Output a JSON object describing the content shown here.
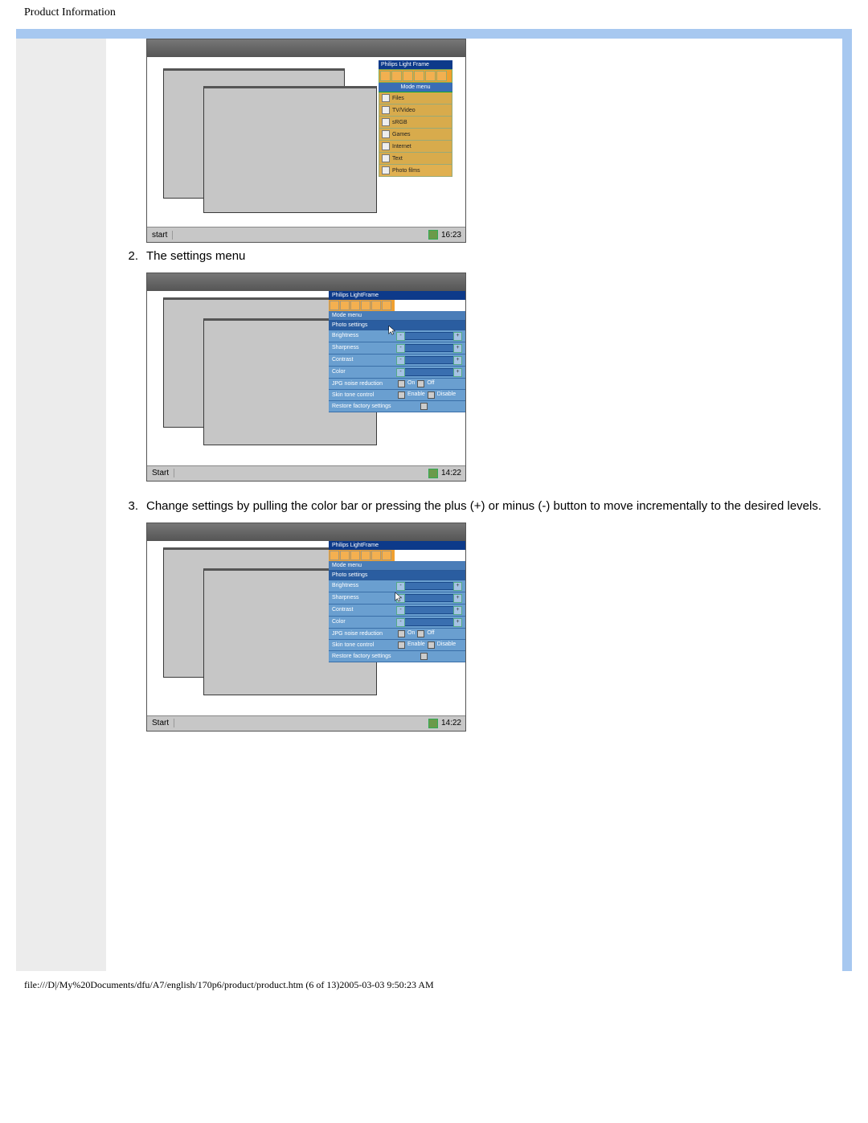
{
  "header": "Product Information",
  "steps": {
    "s2_num": "2.",
    "s2_text": "The settings menu",
    "s3_num": "3.",
    "s3_text": "Change settings by pulling the color bar or pressing the plus (+) or minus (-) button to move incrementally to the desired levels."
  },
  "taskbar": {
    "start": "Start",
    "start1": "start",
    "clock1": "16:23",
    "clock": "14:22"
  },
  "app": {
    "title": "Philips Light Frame",
    "mode_menu": "Mode menu",
    "items": [
      "Files",
      "TV/Video",
      "sRGB",
      "Games",
      "Internet",
      "Text",
      "Photo films"
    ]
  },
  "settings": {
    "title": "Philips LightFrame",
    "mode_menu": "Mode menu",
    "section": "Photo settings",
    "rows": {
      "brightness": "Brightness",
      "sharpness": "Sharpness",
      "contrast": "Contrast",
      "color": "Color",
      "jpg": "JPG noise reduction",
      "skin": "Skin tone control",
      "restore": "Restore factory settings"
    },
    "jpg_on": "On",
    "jpg_off": "Off",
    "skin_enable": "Enable",
    "skin_disable": "Disable"
  },
  "footer": "file:///D|/My%20Documents/dfu/A7/english/170p6/product/product.htm (6 of 13)2005-03-03 9:50:23 AM"
}
